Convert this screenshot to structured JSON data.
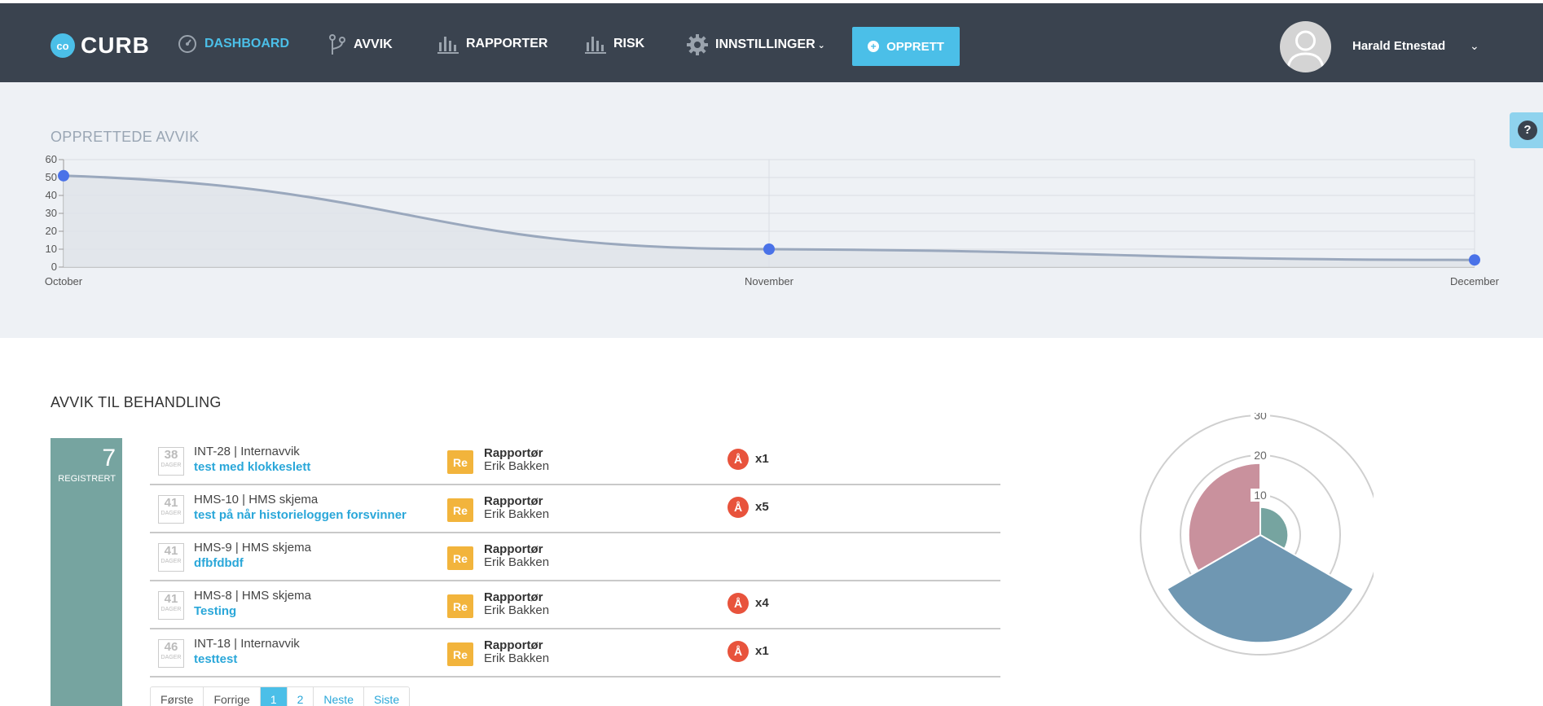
{
  "brand": {
    "logo_mark": "co",
    "name": "CURB",
    "accent": "#4bbfe8"
  },
  "nav": {
    "items": [
      {
        "label": "DASHBOARD",
        "icon": "dashboard-gauge-icon",
        "active": true
      },
      {
        "label": "AVVIK",
        "icon": "branch-icon",
        "active": false
      },
      {
        "label": "RAPPORTER",
        "icon": "bar-chart-icon",
        "active": false
      },
      {
        "label": "RISK",
        "icon": "bar-chart-icon",
        "active": false
      },
      {
        "label": "INNSTILLINGER",
        "icon": "gear-icon",
        "active": false
      }
    ],
    "create_label": "OPPRETT"
  },
  "user": {
    "name": "Harald Etnestad"
  },
  "help": {
    "label": "?"
  },
  "created_chart": {
    "title": "OPPRETTEDE AVVIK"
  },
  "chart_data": [
    {
      "type": "area",
      "title": "OPPRETTEDE AVVIK",
      "categories": [
        "October",
        "November",
        "December"
      ],
      "values": [
        51,
        10,
        4
      ],
      "ylim": [
        0,
        60
      ],
      "yticks": [
        0,
        10,
        20,
        30,
        40,
        50,
        60
      ],
      "grid": true,
      "colors": {
        "line": "#9aa8bd",
        "fill": "#dfe3e9",
        "point": "#4a72e8"
      }
    },
    {
      "type": "polar-area",
      "rticks": [
        10,
        20,
        30
      ],
      "rmax": 30,
      "segments": [
        {
          "value": 7,
          "color": "#76a4a0"
        },
        {
          "value": 27,
          "color": "#6f97b2"
        },
        {
          "value": 18,
          "color": "#c9919d"
        }
      ]
    }
  ],
  "pending": {
    "title": "AVVIK TIL BEHANDLING",
    "count": "7",
    "count_label": "REGISTRERT",
    "days_unit": "DAGER",
    "rows": [
      {
        "days": "38",
        "ref": "INT-28 | Internavvik",
        "title": "test med klokkeslett",
        "badge": "Re",
        "role": "Rapportør",
        "person": "Erik Bakken",
        "alert": "Å",
        "alert_count": "x1"
      },
      {
        "days": "41",
        "ref": "HMS-10 | HMS skjema",
        "title": "test på når historieloggen forsvinner",
        "badge": "Re",
        "role": "Rapportør",
        "person": "Erik Bakken",
        "alert": "Å",
        "alert_count": "x5"
      },
      {
        "days": "41",
        "ref": "HMS-9 | HMS skjema",
        "title": "dfbfdbdf",
        "badge": "Re",
        "role": "Rapportør",
        "person": "Erik Bakken",
        "alert": "",
        "alert_count": ""
      },
      {
        "days": "41",
        "ref": "HMS-8 | HMS skjema",
        "title": "Testing",
        "badge": "Re",
        "role": "Rapportør",
        "person": "Erik Bakken",
        "alert": "Å",
        "alert_count": "x4"
      },
      {
        "days": "46",
        "ref": "INT-18 | Internavvik",
        "title": "testtest",
        "badge": "Re",
        "role": "Rapportør",
        "person": "Erik Bakken",
        "alert": "Å",
        "alert_count": "x1"
      }
    ],
    "pagination": {
      "first": "Første",
      "prev": "Forrige",
      "pages": [
        "1",
        "2"
      ],
      "current": "1",
      "next": "Neste",
      "last": "Siste"
    }
  }
}
